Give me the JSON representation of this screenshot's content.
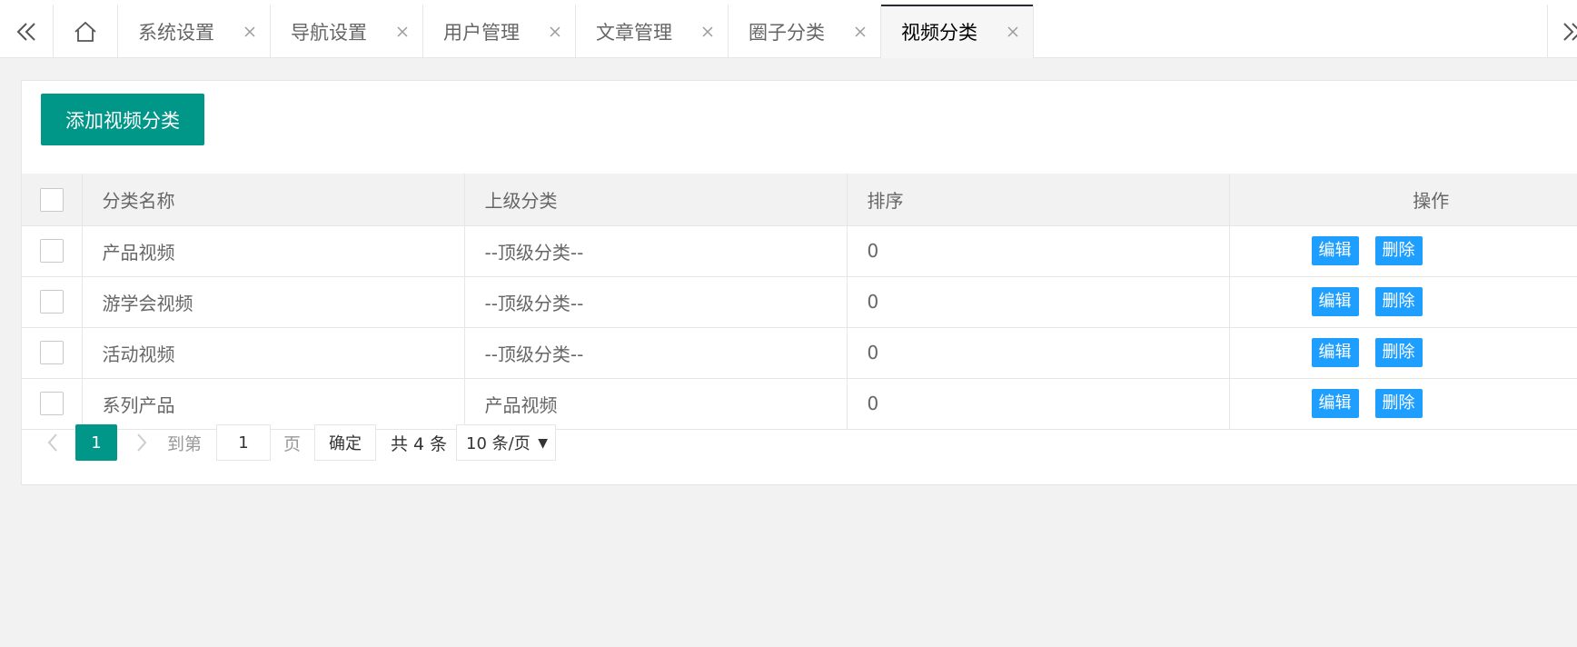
{
  "tabs": [
    {
      "label": "系统设置",
      "active": false
    },
    {
      "label": "导航设置",
      "active": false
    },
    {
      "label": "用户管理",
      "active": false
    },
    {
      "label": "文章管理",
      "active": false
    },
    {
      "label": "圈子分类",
      "active": false
    },
    {
      "label": "视频分类",
      "active": true
    }
  ],
  "toolbar": {
    "add_label": "添加视频分类"
  },
  "table": {
    "headers": {
      "name": "分类名称",
      "parent": "上级分类",
      "sort": "排序",
      "ops": "操作"
    },
    "rows": [
      {
        "name": "产品视频",
        "parent": "--顶级分类--",
        "sort": "0"
      },
      {
        "name": "游学会视频",
        "parent": "--顶级分类--",
        "sort": "0"
      },
      {
        "name": "活动视频",
        "parent": "--顶级分类--",
        "sort": "0"
      },
      {
        "name": "系列产品",
        "parent": "产品视频",
        "sort": "0"
      }
    ],
    "edit_label": "编辑",
    "delete_label": "删除"
  },
  "pager": {
    "current_page": "1",
    "goto_label": "到第",
    "goto_value": "1",
    "page_label": "页",
    "confirm_label": "确定",
    "total_label": "共 4 条",
    "page_size": "10 条/页"
  },
  "colors": {
    "primary": "#009688",
    "action": "#1e9fff"
  },
  "icons": {
    "prev_tabs": "double-chevron-left-icon",
    "home": "home-icon",
    "close": "close-icon",
    "next_tabs": "double-chevron-right-icon"
  }
}
